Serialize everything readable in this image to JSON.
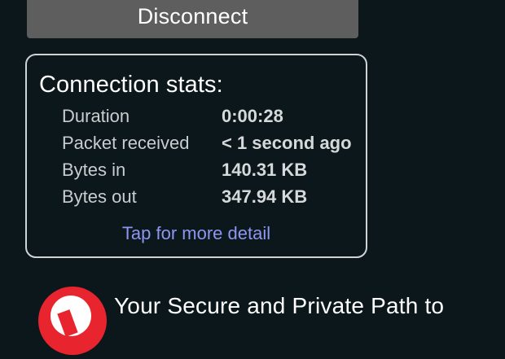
{
  "actions": {
    "disconnect_label": "Disconnect"
  },
  "stats": {
    "title": "Connection stats:",
    "rows": [
      {
        "label": "Duration",
        "value": "0:00:28"
      },
      {
        "label": "Packet received",
        "value": "< 1 second ago"
      },
      {
        "label": "Bytes in",
        "value": "140.31 KB"
      },
      {
        "label": "Bytes out",
        "value": "347.94 KB"
      }
    ],
    "detail_link": "Tap for more detail"
  },
  "promo": {
    "tagline": "Your Secure and Private Path to",
    "logo_icon": "red-circle-logo-icon"
  },
  "colors": {
    "background": "#0b171b",
    "button": "#5e5e5e",
    "link": "#8e96f0",
    "logo": "#e8252e"
  }
}
